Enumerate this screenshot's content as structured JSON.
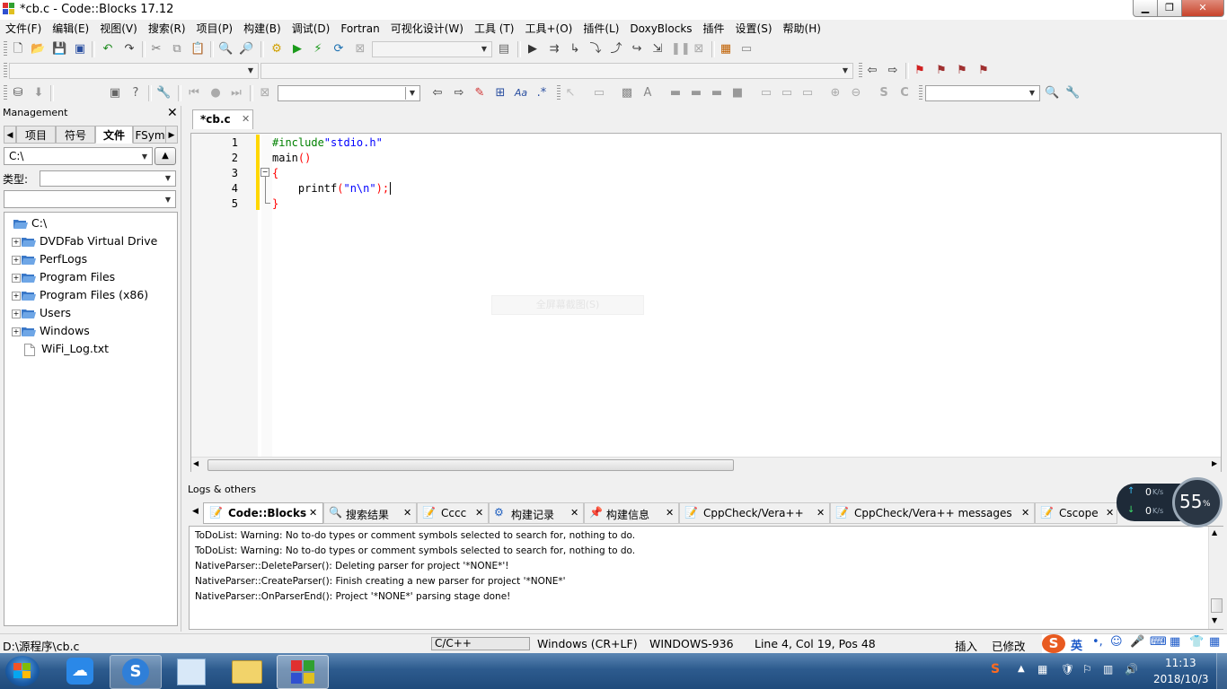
{
  "window": {
    "title": "*cb.c - Code::Blocks 17.12"
  },
  "menu": [
    "文件(F)",
    "编辑(E)",
    "视图(V)",
    "搜索(R)",
    "项目(P)",
    "构建(B)",
    "调试(D)",
    "Fortran",
    "可视化设计(W)",
    "工具 (T)",
    "工具+(O)",
    "插件(L)",
    "DoxyBlocks",
    "插件",
    "设置(S)",
    "帮助(H)"
  ],
  "toolbar3": {
    "comment_btn": "/**",
    "comment2_btn": "*<"
  },
  "management": {
    "title": "Management",
    "tabs": [
      "项目",
      "符号",
      "文件",
      "FSym"
    ],
    "path": "C:\\",
    "type_label": "类型:",
    "tree": [
      {
        "label": "C:\\",
        "kind": "root"
      },
      {
        "label": "DVDFab Virtual Drive",
        "kind": "folder"
      },
      {
        "label": "PerfLogs",
        "kind": "folder"
      },
      {
        "label": "Program Files",
        "kind": "folder"
      },
      {
        "label": "Program Files (x86)",
        "kind": "folder"
      },
      {
        "label": "Users",
        "kind": "folder"
      },
      {
        "label": "Windows",
        "kind": "folder"
      },
      {
        "label": "WiFi_Log.txt",
        "kind": "file"
      }
    ]
  },
  "editor": {
    "tab": "*cb.c",
    "lines": [
      {
        "n": "1",
        "parts": [
          [
            "pp",
            "#include"
          ],
          [
            "str",
            "\"stdio.h\""
          ]
        ]
      },
      {
        "n": "2",
        "parts": [
          [
            "",
            "main"
          ],
          [
            "op",
            "()"
          ]
        ]
      },
      {
        "n": "3",
        "parts": [
          [
            "op",
            "{"
          ]
        ]
      },
      {
        "n": "4",
        "parts": [
          [
            "",
            "    printf"
          ],
          [
            "op",
            "("
          ],
          [
            "str",
            "\"n\\n\""
          ],
          [
            "op",
            ");"
          ]
        ]
      },
      {
        "n": "5",
        "parts": [
          [
            "op",
            "}"
          ]
        ]
      }
    ],
    "overlay_hint": "全屏幕截图(S)"
  },
  "logs": {
    "title": "Logs & others",
    "tabs": [
      "Code::Blocks",
      "搜索结果",
      "Cccc",
      "构建记录",
      "构建信息",
      "CppCheck/Vera++",
      "CppCheck/Vera++ messages",
      "Cscope"
    ],
    "lines": [
      "ToDoList: Warning: No to-do types or comment symbols selected to search for, nothing to do.",
      "ToDoList: Warning: No to-do types or comment symbols selected to search for, nothing to do.",
      "NativeParser::DeleteParser(): Deleting parser for project '*NONE*'!",
      "NativeParser::CreateParser(): Finish creating a new parser for project '*NONE*'",
      "NativeParser::OnParserEnd(): Project '*NONE*' parsing stage done!"
    ]
  },
  "netwidget": {
    "up": "0",
    "down": "0",
    "unit": "K/s",
    "percent": "55",
    "pct_sign": "%"
  },
  "status": {
    "file": "D:\\源程序\\cb.c",
    "lang": "C/C++",
    "eol": "Windows (CR+LF)",
    "encoding": "WINDOWS-936",
    "pos": "Line 4, Col 19, Pos 48",
    "mode": "插入",
    "modified": "已修改",
    "ime": "英"
  },
  "taskbar": {
    "time": "11:13",
    "date": "2018/10/3"
  }
}
